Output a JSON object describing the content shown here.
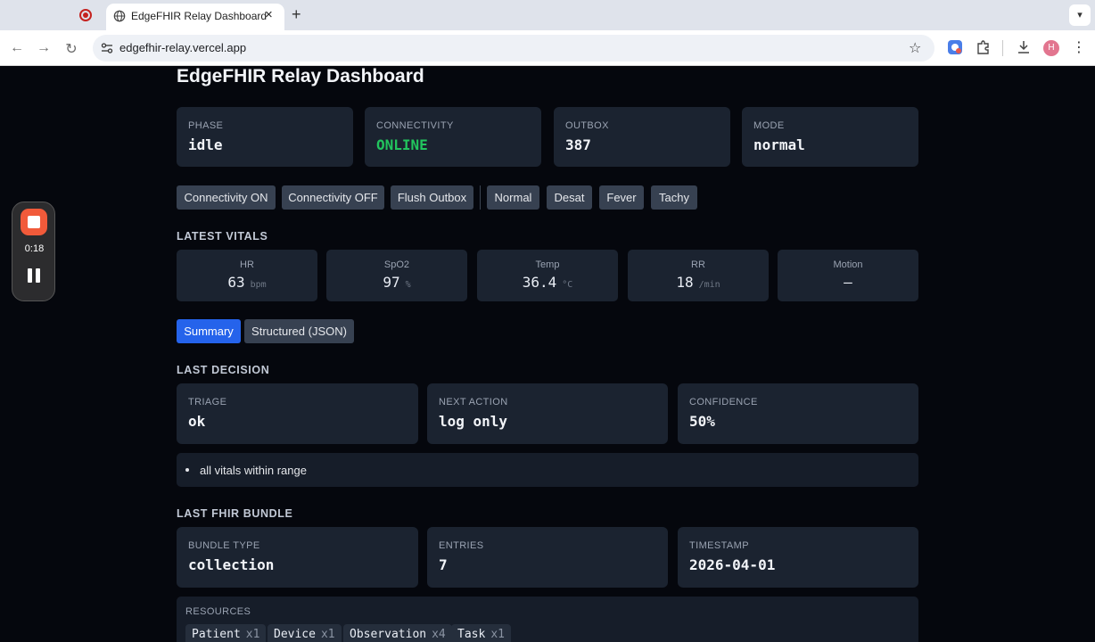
{
  "browser": {
    "tab_title": "EdgeFHIR Relay Dashboard",
    "url": "edgefhir-relay.vercel.app",
    "profile_initial": "H"
  },
  "recorder": {
    "time": "0:18"
  },
  "page": {
    "title": "EdgeFHIR Relay Dashboard"
  },
  "status": {
    "phase": {
      "label": "PHASE",
      "value": "idle"
    },
    "connectivity": {
      "label": "CONNECTIVITY",
      "value": "ONLINE",
      "color": "#22c55e"
    },
    "outbox": {
      "label": "OUTBOX",
      "value": "387"
    },
    "mode": {
      "label": "MODE",
      "value": "normal"
    }
  },
  "controls": {
    "connectivity_on": "Connectivity ON",
    "connectivity_off": "Connectivity OFF",
    "flush_outbox": "Flush Outbox",
    "normal": "Normal",
    "desat": "Desat",
    "fever": "Fever",
    "tachy": "Tachy"
  },
  "vitals": {
    "heading": "LATEST VITALS",
    "items": [
      {
        "label": "HR",
        "value": "63",
        "unit": "bpm"
      },
      {
        "label": "SpO2",
        "value": "97",
        "unit": "%"
      },
      {
        "label": "Temp",
        "value": "36.4",
        "unit": "°C"
      },
      {
        "label": "RR",
        "value": "18",
        "unit": "/min"
      },
      {
        "label": "Motion",
        "value": "—",
        "unit": ""
      }
    ]
  },
  "view_tabs": {
    "summary": "Summary",
    "structured": "Structured (JSON)",
    "active_color": "#2563eb"
  },
  "decision": {
    "heading": "LAST DECISION",
    "triage": {
      "label": "TRIAGE",
      "value": "ok"
    },
    "next_action": {
      "label": "NEXT ACTION",
      "value": "log only"
    },
    "confidence": {
      "label": "CONFIDENCE",
      "value": "50%"
    },
    "reasons": [
      "all vitals within range"
    ]
  },
  "bundle": {
    "heading": "LAST FHIR BUNDLE",
    "type": {
      "label": "BUNDLE TYPE",
      "value": "collection"
    },
    "entries": {
      "label": "ENTRIES",
      "value": "7"
    },
    "timestamp": {
      "label": "TIMESTAMP",
      "value": "2026-04-01"
    },
    "resources_label": "RESOURCES",
    "resources": [
      {
        "name": "Patient",
        "count": "x1"
      },
      {
        "name": "Device",
        "count": "x1"
      },
      {
        "name": "Observation",
        "count": "x4"
      },
      {
        "name": "Task",
        "count": "x1"
      }
    ]
  }
}
